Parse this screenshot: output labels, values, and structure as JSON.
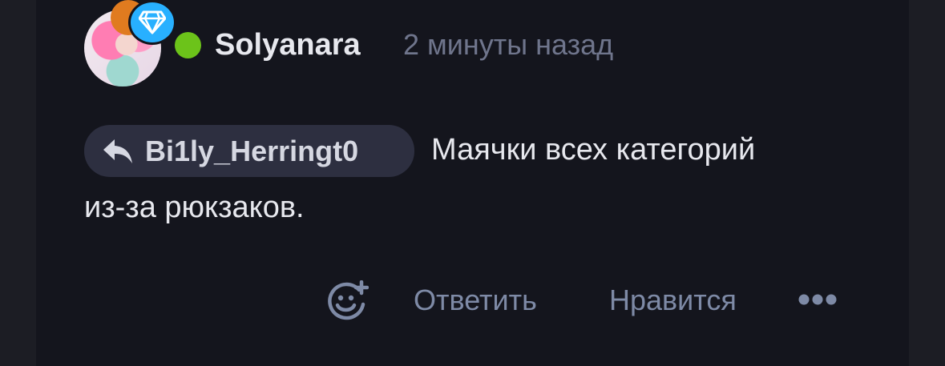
{
  "comment": {
    "author": "Solyanara",
    "time": "2 минуты назад",
    "reply_to": "Bi1ly_Herringt0",
    "text_line1": "Маячки всех категорий",
    "text_line2": "из-за рюкзаков."
  },
  "actions": {
    "reply_label": "Ответить",
    "like_label": "Нравится"
  },
  "icons": {
    "reply_chip": "reply-arrow-icon",
    "reaction": "add-reaction-icon",
    "more": "more-dots-icon",
    "badge": "diamond-icon"
  },
  "colors": {
    "background": "#14151d",
    "online": "#6cc31a",
    "badge_diamond": "#28b0ff",
    "badge_orange": "#e07b1f",
    "muted_text": "#7e8aa6"
  }
}
